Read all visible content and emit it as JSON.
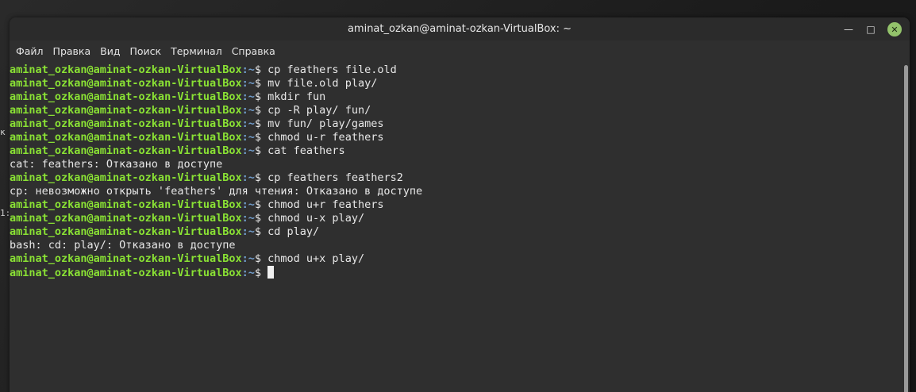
{
  "desktop": {
    "edge_text_1": "к",
    "edge_text_2": "1:"
  },
  "window": {
    "title": "aminat_ozkan@aminat-ozkan-VirtualBox: ~",
    "controls": {
      "minimize": "—",
      "maximize": "□",
      "close": "✕"
    }
  },
  "menu": {
    "items": [
      "Файл",
      "Правка",
      "Вид",
      "Поиск",
      "Терминал",
      "Справка"
    ]
  },
  "terminal": {
    "prompt_user": "aminat_ozkan@aminat-ozkan-VirtualBox",
    "prompt_sep": ":",
    "prompt_path": "~",
    "prompt_dollar": "$ ",
    "lines": [
      {
        "type": "cmd",
        "text": "cp feathers file.old"
      },
      {
        "type": "cmd",
        "text": "mv file.old play/"
      },
      {
        "type": "cmd",
        "text": "mkdir fun"
      },
      {
        "type": "cmd",
        "text": "cp -R play/ fun/"
      },
      {
        "type": "cmd",
        "text": "mv fun/ play/games"
      },
      {
        "type": "cmd",
        "text": "chmod u-r feathers"
      },
      {
        "type": "cmd",
        "text": "cat feathers"
      },
      {
        "type": "out",
        "text": "cat: feathers: Отказано в доступе"
      },
      {
        "type": "cmd",
        "text": "cp feathers feathers2"
      },
      {
        "type": "out",
        "text": "cp: невозможно открыть 'feathers' для чтения: Отказано в доступе"
      },
      {
        "type": "cmd",
        "text": "chmod u+r feathers"
      },
      {
        "type": "cmd",
        "text": "chmod u-x play/"
      },
      {
        "type": "cmd",
        "text": "cd play/"
      },
      {
        "type": "out",
        "text": "bash: cd: play/: Отказано в доступе"
      },
      {
        "type": "cmd",
        "text": "chmod u+x play/"
      },
      {
        "type": "prompt",
        "text": ""
      }
    ]
  },
  "colors": {
    "prompt_user": "#8ae234",
    "prompt_path": "#729fcf",
    "background": "#2f2f2f",
    "close_button": "#93c36b"
  }
}
